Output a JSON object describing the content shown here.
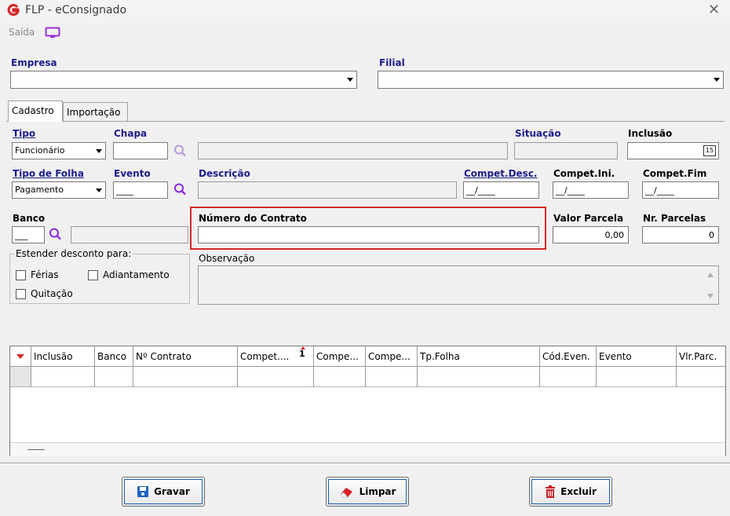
{
  "window": {
    "title": "FLP - eConsignado"
  },
  "menu": {
    "saida": "Saída"
  },
  "empresa": {
    "label": "Empresa",
    "value": ""
  },
  "filial": {
    "label": "Filial",
    "value": ""
  },
  "tabs": [
    {
      "label": "Cadastro"
    },
    {
      "label": "Importação"
    }
  ],
  "form": {
    "tipo": {
      "label": "Tipo",
      "value": "Funcionário"
    },
    "chapa": {
      "label": "Chapa",
      "value": ""
    },
    "situacao": {
      "label": "Situação",
      "value": ""
    },
    "inclusao": {
      "label": "Inclusão",
      "value": ""
    },
    "tipo_folha": {
      "label": "Tipo de Folha",
      "value": "Pagamento"
    },
    "evento": {
      "label": "Evento",
      "value": "____"
    },
    "descricao": {
      "label": "Descrição",
      "value": ""
    },
    "compet_desc": {
      "label": "Compet.Desc.",
      "value": "__/____"
    },
    "compet_ini": {
      "label": "Compet.Ini.",
      "value": "__/____"
    },
    "compet_fim": {
      "label": "Compet.Fim",
      "value": "__/____"
    },
    "banco": {
      "label": "Banco",
      "value": "___"
    },
    "numero_contrato": {
      "label": "Número do Contrato",
      "value": ""
    },
    "valor_parcela": {
      "label": "Valor Parcela",
      "value": "0,00"
    },
    "nr_parcelas": {
      "label": "Nr. Parcelas",
      "value": "0"
    },
    "estender": {
      "label": "Estender desconto para:",
      "ferias": "Férias",
      "adiantamento": "Adiantamento",
      "quitacao": "Quitação"
    },
    "observacao": {
      "label": "Observação",
      "value": ""
    },
    "calendar_day": "15"
  },
  "grid": {
    "columns": [
      "Inclusão",
      "Banco",
      "Nº Contrato",
      "Compet....",
      "Compe...",
      "Compe...",
      "Tp.Folha",
      "Cód.Even.",
      "Evento",
      "Vlr.Parc."
    ],
    "sort_indicator": "1",
    "rows": []
  },
  "buttons": {
    "gravar": "Gravar",
    "limpar": "Limpar",
    "excluir": "Excluir"
  },
  "colors": {
    "highlight": "#d62828",
    "label_blue": "#1c1c8c",
    "search_icon": "#8a2be2"
  }
}
